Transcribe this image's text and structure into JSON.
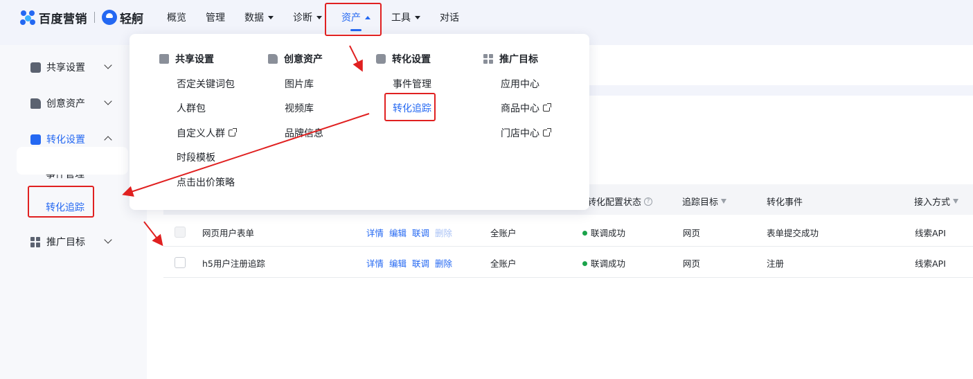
{
  "brand": {
    "baidu": "百度营销",
    "qingzhou": "轻舸"
  },
  "nav": [
    {
      "label": "概览"
    },
    {
      "label": "管理"
    },
    {
      "label": "数据"
    },
    {
      "label": "诊断"
    },
    {
      "label": "资产"
    },
    {
      "label": "工具"
    },
    {
      "label": "对话"
    }
  ],
  "sidebar": {
    "items": [
      {
        "label": "共享设置"
      },
      {
        "label": "创意资产"
      },
      {
        "label": "转化设置"
      },
      {
        "label": "推广目标"
      }
    ],
    "sub": [
      {
        "label": "事件管理"
      },
      {
        "label": "转化追踪"
      }
    ]
  },
  "dropdown": {
    "columns": [
      {
        "title": "共享设置",
        "items": [
          "否定关键词包",
          "人群包",
          "自定义人群",
          "时段模板",
          "点击出价策略"
        ]
      },
      {
        "title": "创意资产",
        "items": [
          "图片库",
          "视频库",
          "品牌信息"
        ]
      },
      {
        "title": "转化设置",
        "items": [
          "事件管理",
          "转化追踪"
        ]
      },
      {
        "title": "推广目标",
        "items": [
          "应用中心",
          "商品中心",
          "门店中心"
        ]
      }
    ]
  },
  "table": {
    "headers": {
      "status": "转化配置状态",
      "target": "追踪目标",
      "event": "转化事件",
      "method": "接入方式"
    },
    "actions": [
      "详情",
      "编辑",
      "联调",
      "删除"
    ],
    "rows": [
      {
        "name": "网页用户表单",
        "account": "全账户",
        "status": "联调成功",
        "target": "网页",
        "event": "表单提交成功",
        "method": "线索API"
      },
      {
        "name": "h5用户注册追踪",
        "account": "全账户",
        "status": "联调成功",
        "target": "网页",
        "event": "注册",
        "method": "线索API"
      }
    ]
  },
  "colors": {
    "accent": "#2468f2",
    "annotation": "#e02020",
    "success": "#1aa34a"
  }
}
